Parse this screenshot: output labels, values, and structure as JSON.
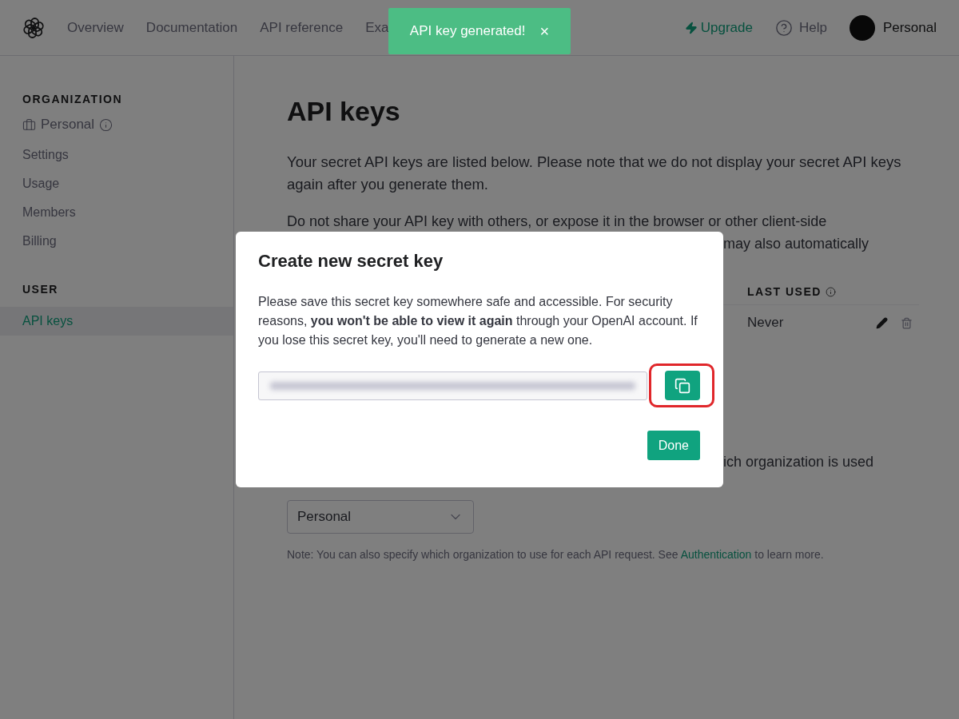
{
  "nav": {
    "links": [
      {
        "label": "Overview",
        "selected": false
      },
      {
        "label": "Documentation",
        "selected": false
      },
      {
        "label": "API reference",
        "selected": false
      },
      {
        "label": "Exa",
        "selected": false
      }
    ],
    "upgrade": "Upgrade",
    "help": "Help",
    "account": "Personal"
  },
  "toast": {
    "message": "API key generated!",
    "close": "×"
  },
  "sidebar": {
    "sections": [
      {
        "heading": "ORGANIZATION",
        "org": "Personal",
        "items": [
          {
            "label": "Settings",
            "selected": false
          },
          {
            "label": "Usage",
            "selected": false
          },
          {
            "label": "Members",
            "selected": false
          },
          {
            "label": "Billing",
            "selected": false
          }
        ]
      },
      {
        "heading": "USER",
        "items": [
          {
            "label": "API keys",
            "selected": true
          }
        ]
      }
    ]
  },
  "page": {
    "title": "API keys",
    "intro": "Your secret API keys are listed below. Please note that we do not display your secret API keys again after you generate them.",
    "warning_line": "Do not share your API key with others, or expose it in the browser or other client-side",
    "warning_tail": "may also automatically",
    "table": {
      "column_header": "LAST USED",
      "rows": [
        {
          "last_used": "Never"
        }
      ]
    },
    "org_text_tail": "ich organization is used",
    "org_select": "Personal",
    "note": {
      "before": "Note: You can also specify which organization to use for each API request. See ",
      "link": "Authentication",
      "after": " to learn more."
    }
  },
  "modal": {
    "title": "Create new secret key",
    "body": "Please save this secret key somewhere safe and accessible. For security reasons, **you won't be able to view it again** through your OpenAI account. If you lose this secret key, you'll need to generate a new one.",
    "highlight_copy": true,
    "done": "Done"
  }
}
